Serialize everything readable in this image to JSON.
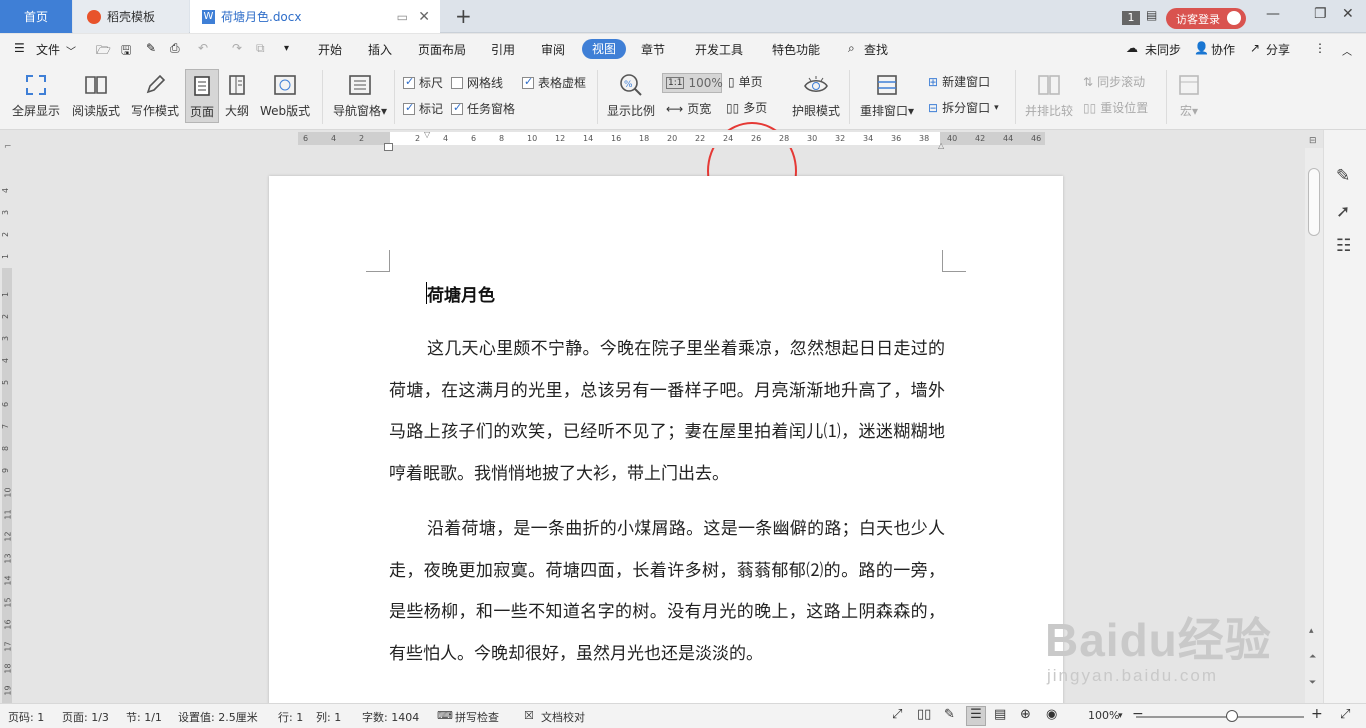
{
  "tabs": {
    "home": "首页",
    "templates": "稻壳模板",
    "document": "荷塘月色.docx",
    "new_tab": "+"
  },
  "titlebar": {
    "page_badge": "1",
    "login": "访客登录"
  },
  "menu": {
    "file": "文件",
    "items": [
      "开始",
      "插入",
      "页面布局",
      "引用",
      "审阅",
      "视图",
      "章节",
      "开发工具",
      "特色功能"
    ],
    "search": "查找",
    "unsynced": "未同步",
    "collaborate": "协作",
    "share": "分享"
  },
  "ribbon": {
    "fullscreen": "全屏显示",
    "reading": "阅读版式",
    "writing": "写作模式",
    "page": "页面",
    "outline": "大纲",
    "web": "Web版式",
    "nav_pane": "导航窗格",
    "ruler": "标尺",
    "gridlines": "网格线",
    "table_gridlines": "表格虚框",
    "markup": "标记",
    "task_pane": "任务窗格",
    "zoom_label": "显示比例",
    "zoom_value": "100%",
    "page_width": "页宽",
    "single_page": "单页",
    "multi_page": "多页",
    "eye_mode": "护眼模式",
    "rearrange": "重排窗口",
    "new_window": "新建窗口",
    "split_window": "拆分窗口",
    "side_by_side": "并排比较",
    "sync_scroll": "同步滚动",
    "reset_position": "重设位置",
    "macro": "宏"
  },
  "ruler_h": [
    "6",
    "4",
    "2",
    "2",
    "4",
    "6",
    "8",
    "10",
    "12",
    "14",
    "16",
    "18",
    "20",
    "22",
    "24",
    "26",
    "28",
    "30",
    "32",
    "34",
    "36",
    "38",
    "40",
    "42",
    "44",
    "46"
  ],
  "ruler_v": [
    "4",
    "3",
    "2",
    "1",
    "1",
    "2",
    "3",
    "4",
    "5",
    "6",
    "7",
    "8",
    "9",
    "10",
    "11",
    "12",
    "13",
    "14",
    "15",
    "16",
    "17",
    "18",
    "19",
    "20"
  ],
  "document": {
    "title": "荷塘月色",
    "paragraphs": [
      "这几天心里颇不宁静。今晚在院子里坐着乘凉，忽然想起日日走过的荷塘，在这满月的光里，总该另有一番样子吧。月亮渐渐地升高了，墙外马路上孩子们的欢笑，已经听不见了；妻在屋里拍着闰儿⑴，迷迷糊糊地哼着眠歌。我悄悄地披了大衫，带上门出去。",
      "沿着荷塘，是一条曲折的小煤屑路。这是一条幽僻的路；白天也少人走，夜晚更加寂寞。荷塘四面，长着许多树，蓊蓊郁郁⑵的。路的一旁，是些杨柳，和一些不知道名字的树。没有月光的晚上，这路上阴森森的，有些怕人。今晚却很好，虽然月光也还是淡淡的。"
    ]
  },
  "status": {
    "page_code": "页码: 1",
    "page": "页面: 1/3",
    "section": "节: 1/1",
    "setting": "设置值: 2.5厘米",
    "line": "行: 1",
    "column": "列: 1",
    "word_count": "字数: 1404",
    "spell_check": "拼写检查",
    "doc_check": "文档校对",
    "zoom": "100%"
  },
  "watermark": {
    "brand": "Baidu经验",
    "url": "jingyan.baidu.com"
  },
  "colors": {
    "accent": "#3f7fd6",
    "login": "#d9534f",
    "annotation_circle": "#e53935"
  }
}
